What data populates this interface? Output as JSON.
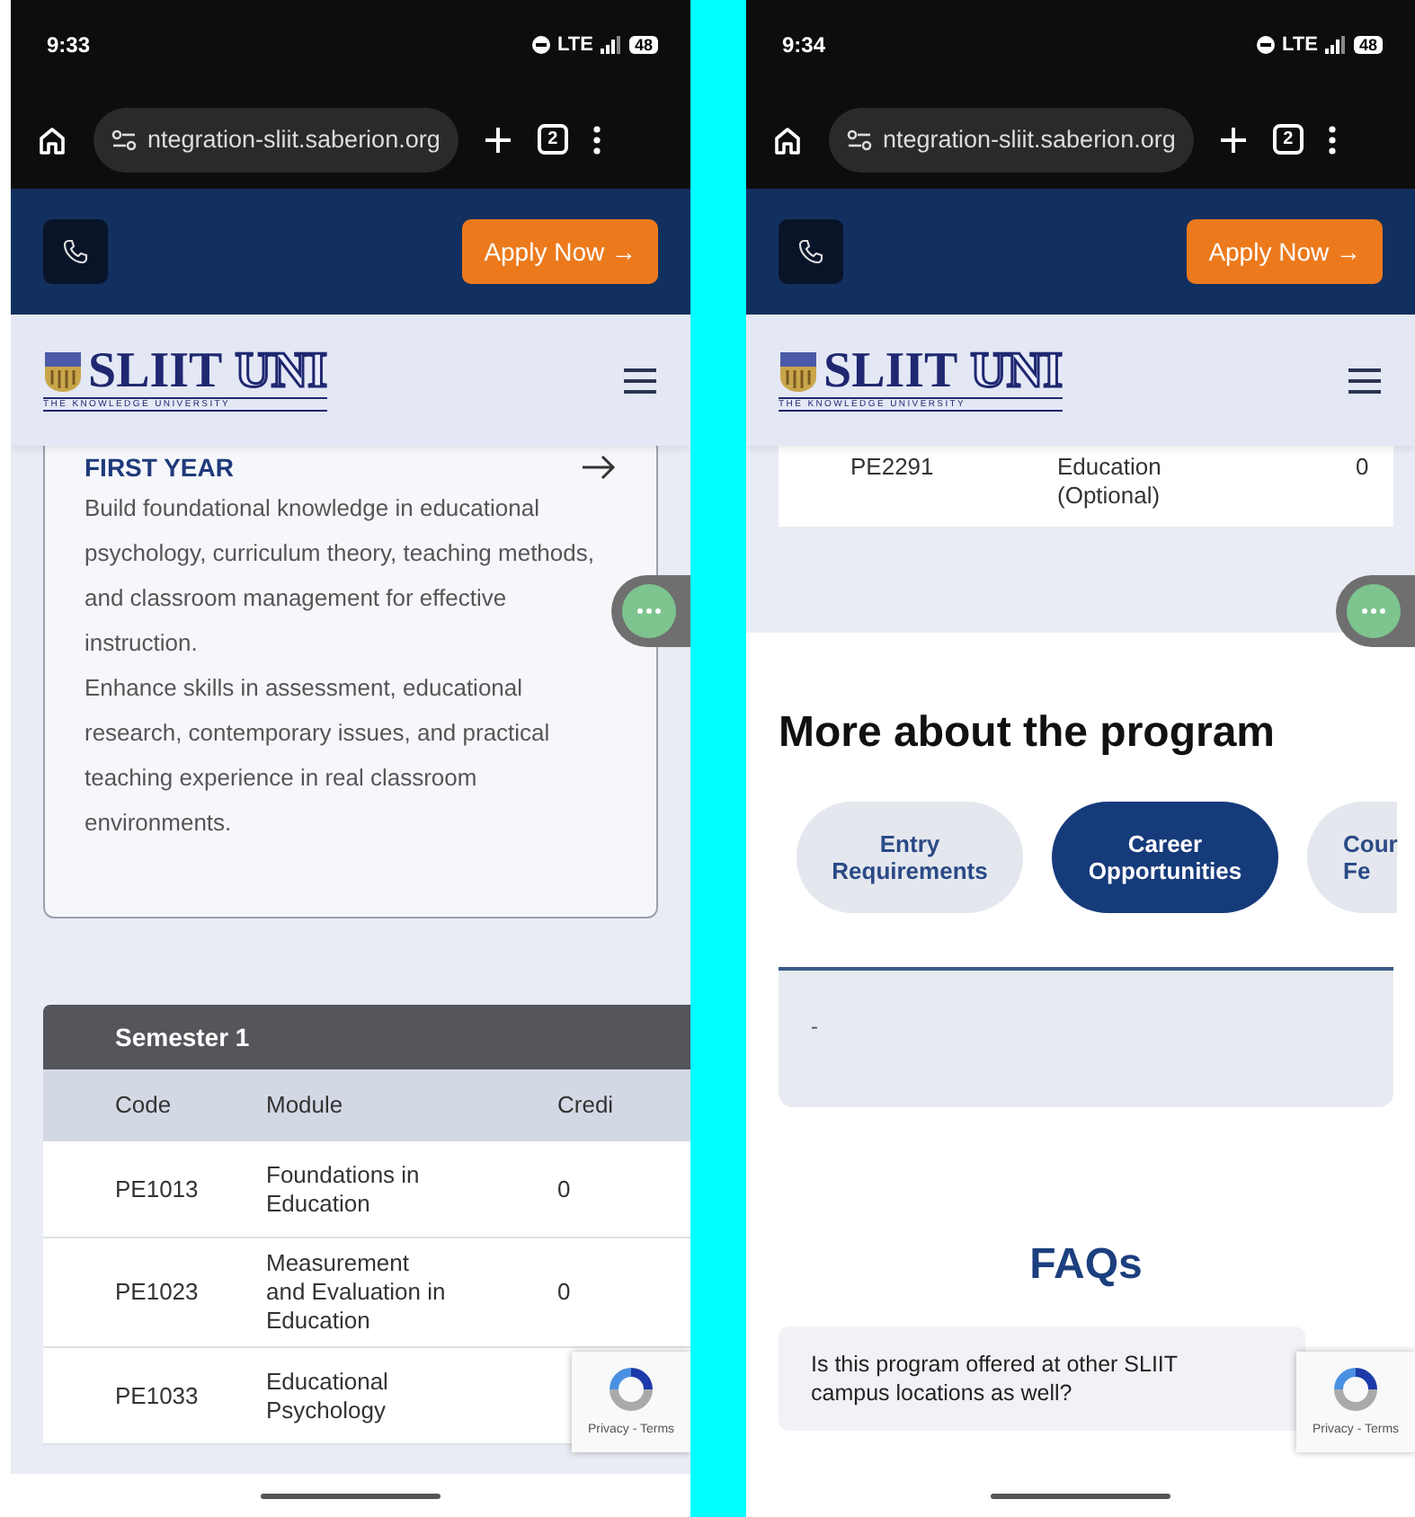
{
  "screens": [
    {
      "status_bar": {
        "time": "9:33",
        "network": "LTE",
        "battery": "48"
      },
      "browser": {
        "url": "ntegration-sliit.saberion.org",
        "tab_count": "2"
      },
      "top_bar": {
        "apply_button": "Apply Now →"
      },
      "logo": {
        "name": "SLIIT",
        "suffix": "UNI",
        "tagline": "THE KNOWLEDGE UNIVERSITY"
      },
      "sections": [
        {
          "kind": "year_card",
          "title": "FIRST YEAR",
          "paragraphs": [
            "Build foundational knowledge in educational psychology, curriculum theory, teaching methods, and classroom management for effective instruction.",
            "Enhance skills in assessment, educational research, contemporary issues, and practical teaching experience in real classroom environments."
          ]
        },
        {
          "kind": "module_table",
          "title": "Semester 1",
          "columns": [
            "Code",
            "Module",
            "Credi"
          ],
          "rows": [
            [
              "PE1013",
              "Foundations in Education",
              "0"
            ],
            [
              "PE1023",
              "Measurement and Evaluation in Education",
              "0"
            ],
            [
              "PE1033",
              "Educational Psychology"
            ]
          ]
        }
      ],
      "recaptcha": "Privacy - Terms"
    },
    {
      "status_bar": {
        "time": "9:34",
        "network": "LTE",
        "battery": "48"
      },
      "browser": {
        "url": "ntegration-sliit.saberion.org",
        "tab_count": "2"
      },
      "top_bar": {
        "apply_button": "Apply Now →"
      },
      "logo": {
        "name": "SLIIT",
        "suffix": "UNI",
        "tagline": "THE KNOWLEDGE UNIVERSITY"
      },
      "sections": [
        {
          "kind": "table_fragment",
          "row": [
            "PE2291",
            "Education (Optional)",
            "0"
          ]
        },
        {
          "kind": "more_about",
          "title": "More about the program",
          "tabs": [
            {
              "label": "Entry Requirements",
              "selected": false
            },
            {
              "label": "Career Opportunities",
              "selected": true
            },
            {
              "label": "Cour Fe",
              "selected": false
            }
          ],
          "panel_text": "-",
          "faq_title": "FAQs",
          "faqs": [
            "Is this program offered at other SLIIT campus locations as well?"
          ]
        }
      ],
      "recaptcha": "Privacy - Terms"
    }
  ]
}
